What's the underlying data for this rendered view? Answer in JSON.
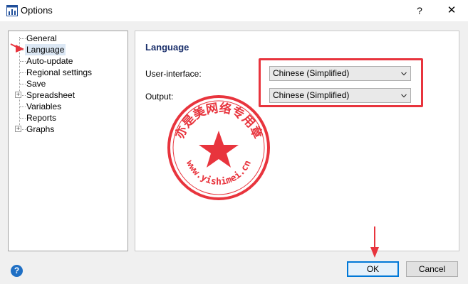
{
  "window": {
    "title": "Options",
    "help_glyph": "?",
    "close_glyph": "✕"
  },
  "tree": {
    "items": [
      {
        "label": "General",
        "expandable": false,
        "selected": false
      },
      {
        "label": "Language",
        "expandable": false,
        "selected": true
      },
      {
        "label": "Auto-update",
        "expandable": false,
        "selected": false
      },
      {
        "label": "Regional settings",
        "expandable": false,
        "selected": false
      },
      {
        "label": "Save",
        "expandable": false,
        "selected": false
      },
      {
        "label": "Spreadsheet",
        "expandable": true,
        "selected": false
      },
      {
        "label": "Variables",
        "expandable": false,
        "selected": false
      },
      {
        "label": "Reports",
        "expandable": false,
        "selected": false
      },
      {
        "label": "Graphs",
        "expandable": true,
        "selected": false
      }
    ]
  },
  "panel": {
    "title": "Language",
    "fields": [
      {
        "label": "User-interface:",
        "value": "Chinese (Simplified)"
      },
      {
        "label": "Output:",
        "value": "Chinese (Simplified)"
      }
    ]
  },
  "stamp": {
    "text_top": "亦是美网络专用章",
    "text_bottom": "www.yishimei.cn"
  },
  "footer": {
    "help_glyph": "?",
    "ok_label": "OK",
    "cancel_label": "Cancel"
  },
  "colors": {
    "annotation_red": "#e8343d",
    "accent_blue": "#0078d7",
    "title_navy": "#1a2f6b"
  }
}
